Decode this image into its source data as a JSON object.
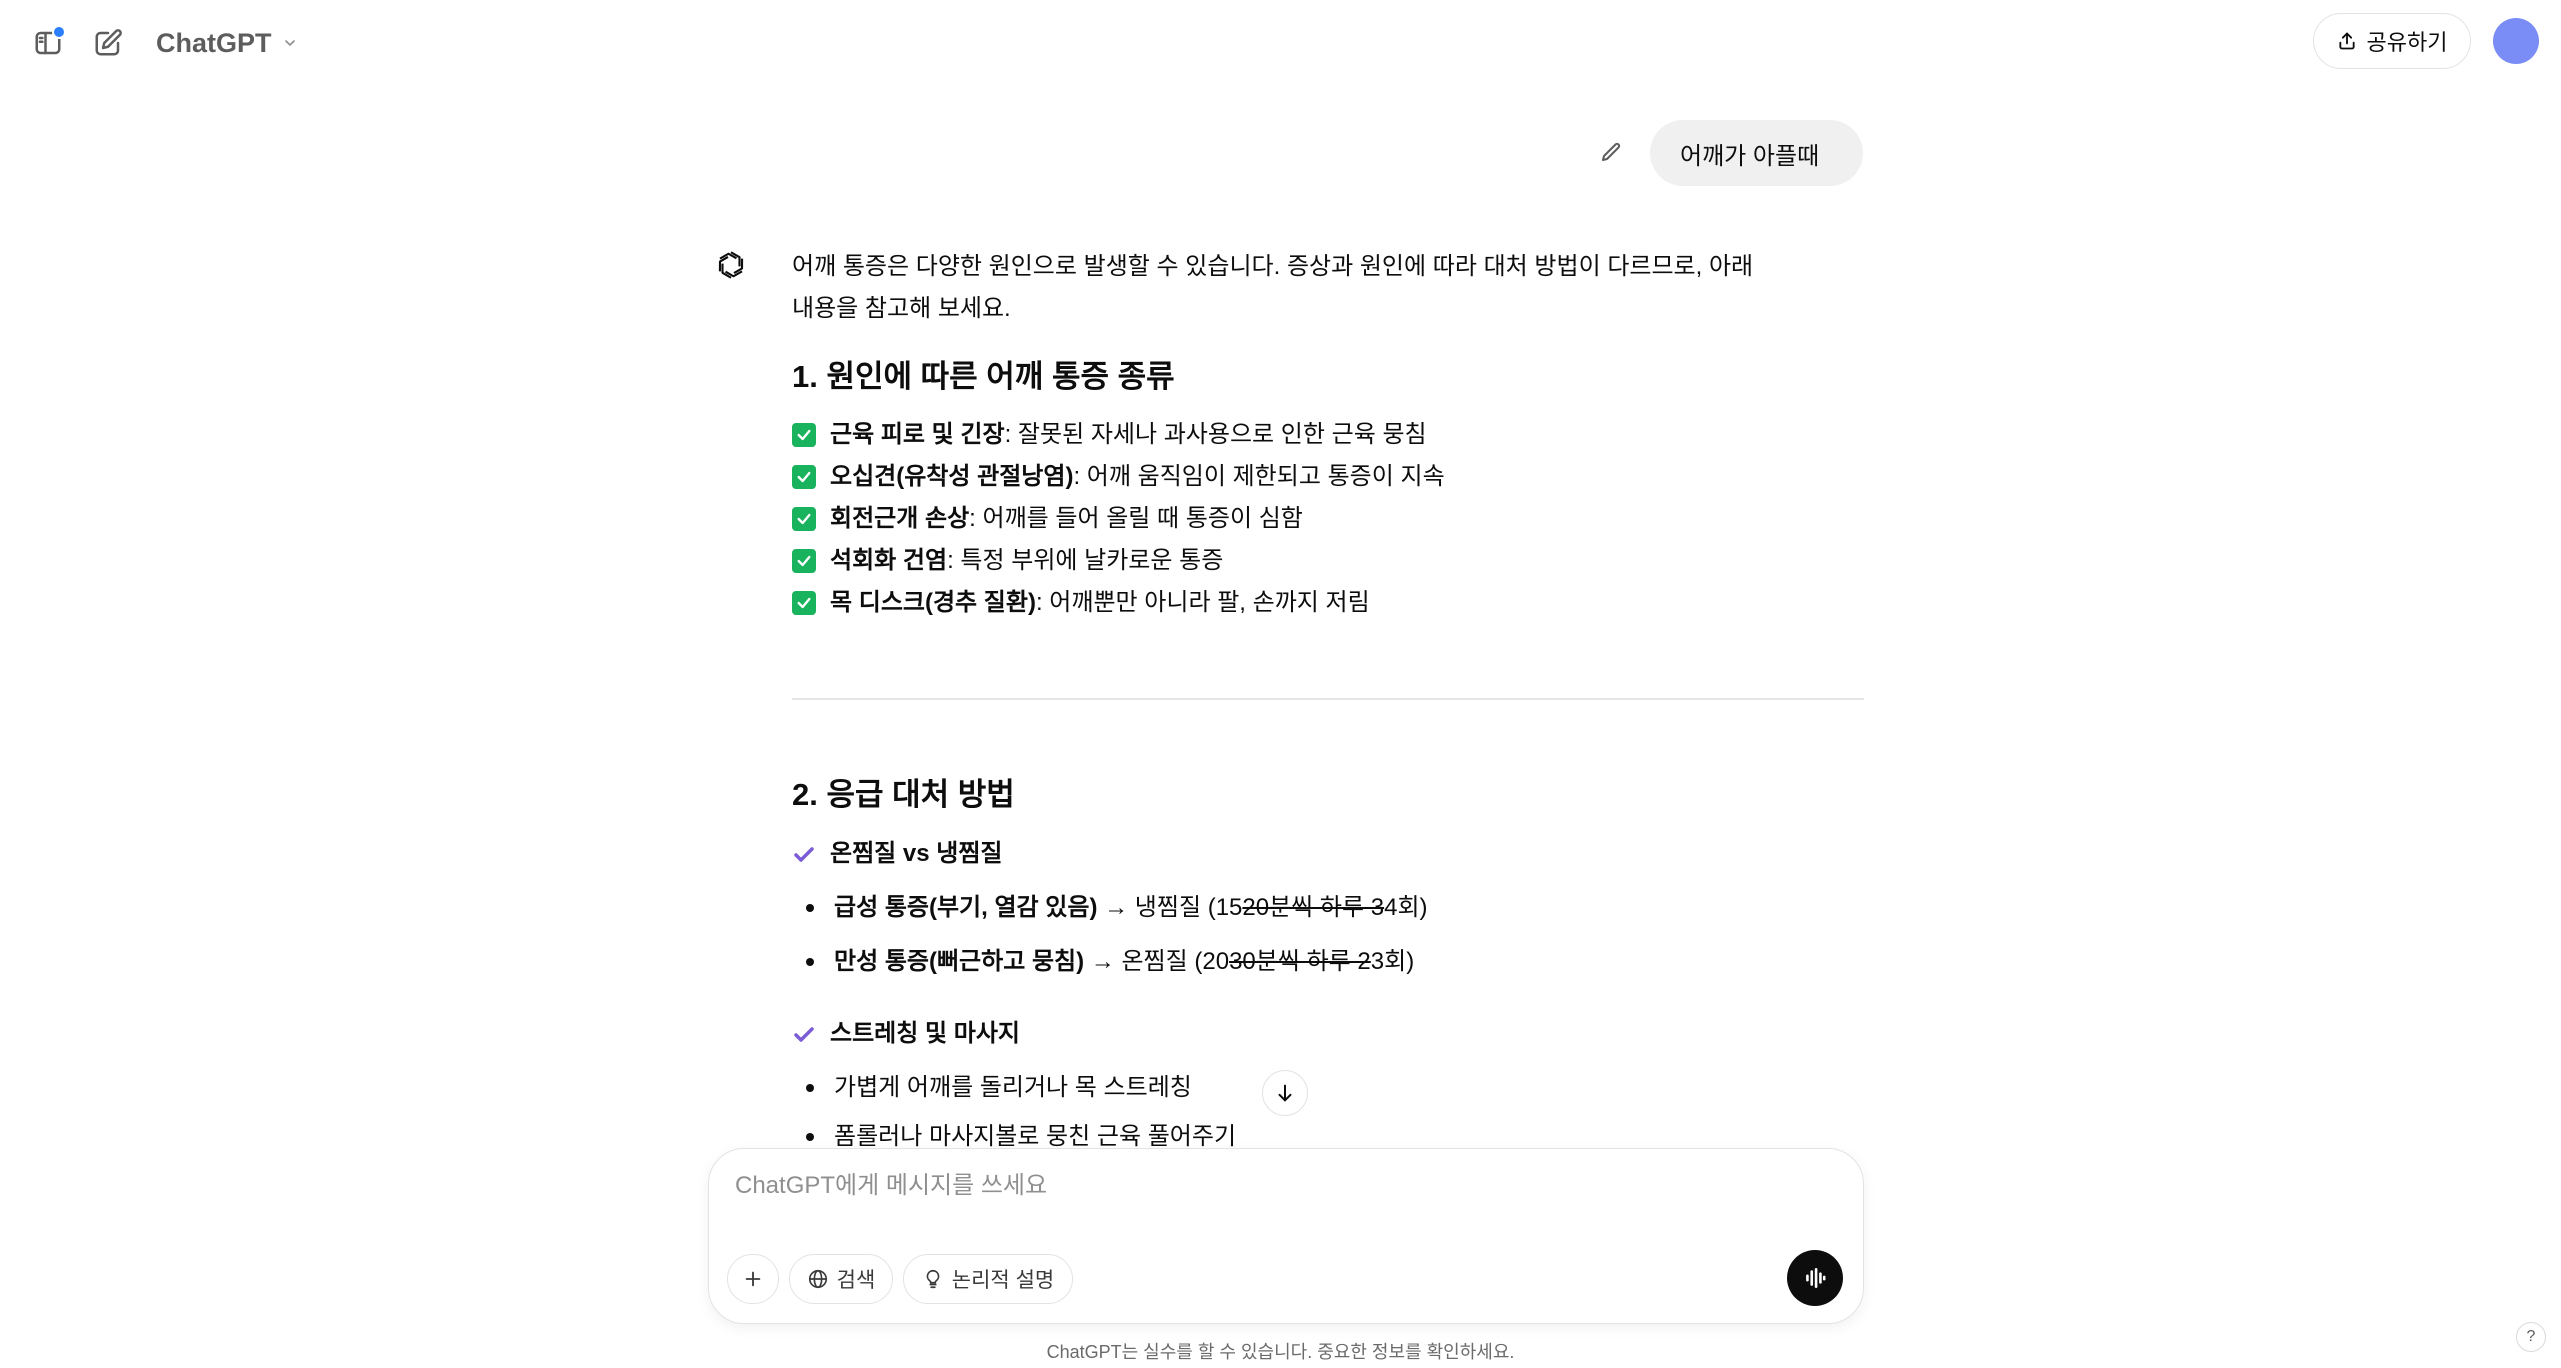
{
  "header": {
    "model_name": "ChatGPT",
    "share_label": "공유하기"
  },
  "user_message": "어깨가 아플때",
  "answer": {
    "intro_line1": "어깨 통증은 다양한 원인으로 발생할 수 있습니다. 증상과 원인에 따라 대처 방법이 다르므로, 아래",
    "intro_line2": "내용을 참고해 보세요.",
    "section1": {
      "title": "1. 원인에 따른 어깨 통증 종류",
      "items": [
        {
          "term": "근육 피로 및 긴장",
          "desc": ": 잘못된 자세나 과사용으로 인한 근육 뭉침"
        },
        {
          "term": "오십견(유착성 관절낭염)",
          "desc": ": 어깨 움직임이 제한되고 통증이 지속"
        },
        {
          "term": "회전근개 손상",
          "desc": ": 어깨를 들어 올릴 때 통증이 심함"
        },
        {
          "term": "석회화 건염",
          "desc": ": 특정 부위에 날카로운 통증"
        },
        {
          "term": "목 디스크(경추 질환)",
          "desc": ": 어깨뿐만 아니라 팔, 손까지 저림"
        }
      ]
    },
    "section2": {
      "title": "2. 응급 대처 방법",
      "sub1": {
        "title": "온찜질 vs 냉찜질",
        "bullets": [
          {
            "bold": "급성 통증(부기, 열감 있음)",
            "arrow": " → 냉찜질 (15",
            "strike": "20분씩 하루 3",
            "tail": "4회)"
          },
          {
            "bold": "만성 통증(뻐근하고 뭉침)",
            "arrow": " → 온찜질 (20",
            "strike": "30분씩 하루 2",
            "tail": "3회)"
          }
        ]
      },
      "sub2": {
        "title": "스트레칭 및 마사지",
        "bullets": [
          "가볍게 어깨를 돌리거나 목 스트레칭",
          "폼롤러나 마사지볼로 뭉친 근육 풀어주기"
        ]
      }
    }
  },
  "composer": {
    "placeholder": "ChatGPT에게 메시지를 쓰세요",
    "search_label": "검색",
    "reason_label": "논리적 설명"
  },
  "footer": {
    "disclaimer": "ChatGPT는 실수를 할 수 있습니다. 중요한 정보를 확인하세요.",
    "help": "?"
  },
  "colors": {
    "check_green": "#18b35c",
    "check_purple": "#7b5cd6",
    "avatar": "#7a8cf5",
    "notification": "#2b7fff"
  }
}
